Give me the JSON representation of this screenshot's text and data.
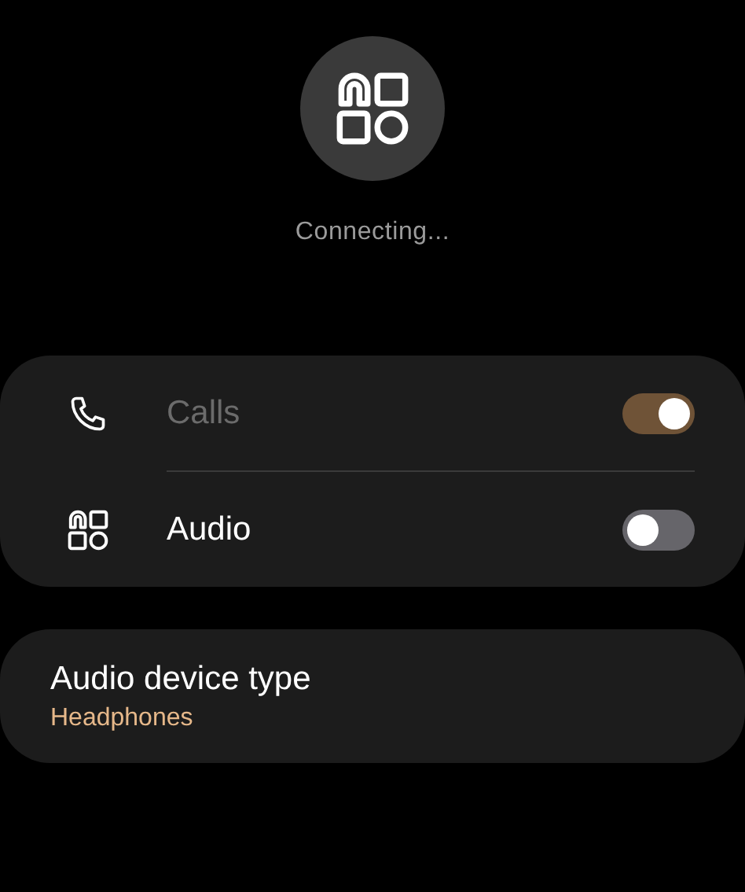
{
  "header": {
    "status": "Connecting..."
  },
  "toggles": [
    {
      "label": "Calls",
      "disabled": true,
      "on": true
    },
    {
      "label": "Audio",
      "disabled": false,
      "on": false
    }
  ],
  "device_type": {
    "title": "Audio device type",
    "value": "Headphones"
  }
}
